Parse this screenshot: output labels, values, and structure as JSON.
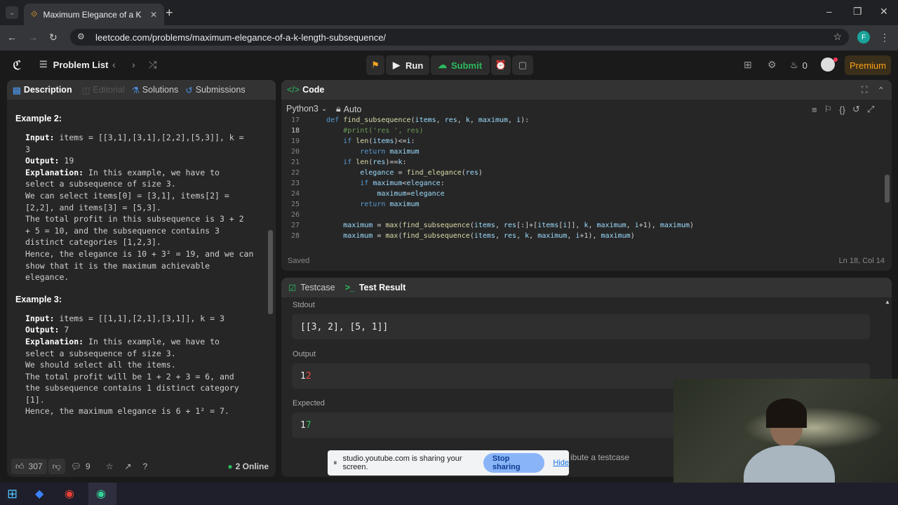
{
  "browser": {
    "tab_title": "Maximum Elegance of a K-Leng",
    "url": "leetcode.com/problems/maximum-elegance-of-a-k-length-subsequence/",
    "profile_initial": "F"
  },
  "nav": {
    "problem_list": "Problem List",
    "run": "Run",
    "submit": "Submit",
    "streak": "0",
    "premium": "Premium"
  },
  "left_tabs": {
    "description": "Description",
    "editorial": "Editorial",
    "solutions": "Solutions",
    "submissions": "Submissions"
  },
  "description": {
    "ex2_title": "Example 2:",
    "ex2_input_label": "Input:",
    "ex2_input": " items = [[3,1],[3,1],[2,2],[5,3]], k =",
    "ex2_input_cont": "3",
    "ex2_output_label": "Output:",
    "ex2_output": " 19",
    "ex2_expl_label": "Explanation:",
    "ex2_expl1": " In this example, we have to",
    "ex2_lines": [
      "select a subsequence of size 3.",
      "We can select items[0] = [3,1], items[2] =",
      "[2,2], and items[3] = [5,3].",
      "The total profit in this subsequence is 3 + 2",
      "+ 5 = 10, and the subsequence contains 3",
      "distinct categories [1,2,3].",
      "Hence, the elegance is 10 + 3² = 19, and we can",
      "show that it is the maximum achievable",
      "elegance."
    ],
    "ex3_title": "Example 3:",
    "ex3_input_label": "Input:",
    "ex3_input": " items = [[1,1],[2,1],[3,1]], k = 3",
    "ex3_output_label": "Output:",
    "ex3_output": " 7",
    "ex3_expl_label": "Explanation:",
    "ex3_expl1": " In this example, we have to",
    "ex3_lines": [
      "select a subsequence of size 3.",
      "We should select all the items.",
      "The total profit will be 1 + 2 + 3 = 6, and",
      "the subsequence contains 1 distinct category",
      "[1].",
      "Hence, the maximum elegance is 6 + 1² = 7."
    ]
  },
  "footer": {
    "likes": "307",
    "comments": "9",
    "online": "2 Online"
  },
  "code": {
    "title": "Code",
    "language": "Python3",
    "mode": "Auto",
    "saved": "Saved",
    "cursor": "Ln 18, Col 14"
  },
  "result": {
    "testcase_tab": "Testcase",
    "result_tab": "Test Result",
    "stdout_label": "Stdout",
    "stdout": "[[3, 2], [5, 1]]",
    "output_label": "Output",
    "output_a": "1",
    "output_b": "2",
    "expected_label": "Expected",
    "expected_a": "1",
    "expected_b": "7",
    "contribute": "ibute a testcase"
  },
  "share": {
    "text": "studio.youtube.com is sharing your screen.",
    "stop": "Stop sharing",
    "hide": "Hide"
  }
}
